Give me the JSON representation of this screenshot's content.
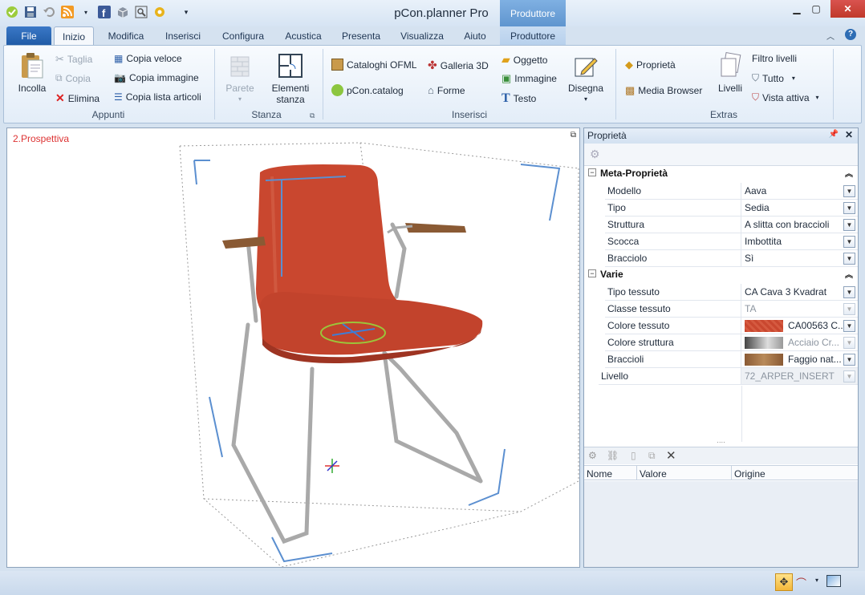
{
  "app": {
    "title": "pCon.planner Pro",
    "context_tab_header": "Produttore"
  },
  "tabs": [
    "File",
    "Inizio",
    "Modifica",
    "Inserisci",
    "Configura",
    "Acustica",
    "Presenta",
    "Visualizza",
    "Aiuto",
    "Produttore"
  ],
  "ribbon": {
    "appunti": {
      "incolla": "Incolla",
      "taglia": "Taglia",
      "copia": "Copia",
      "elimina": "Elimina",
      "copia_veloce": "Copia veloce",
      "copia_immagine": "Copia immagine",
      "copia_lista": "Copia lista articoli",
      "label": "Appunti"
    },
    "stanza": {
      "parete": "Parete",
      "elementi_1": "Elementi",
      "elementi_2": "stanza",
      "label": "Stanza"
    },
    "inserisci": {
      "cataloghi": "Cataloghi OFML",
      "pcon_catalog": "pCon.catalog",
      "galleria": "Galleria 3D",
      "forme": "Forme",
      "oggetto": "Oggetto",
      "immagine": "Immagine",
      "testo": "Testo",
      "disegna": "Disegna",
      "label": "Inserisci"
    },
    "extras": {
      "proprieta": "Proprietà",
      "media": "Media Browser",
      "livelli": "Livelli",
      "filtro": "Filtro livelli",
      "tutto": "Tutto",
      "vista": "Vista attiva",
      "label": "Extras"
    }
  },
  "viewport": {
    "label": "2.Prospettiva"
  },
  "properties": {
    "title": "Proprietà",
    "meta_title": "Meta-Proprietà",
    "meta_rows": [
      {
        "name": "Modello",
        "value": "Aava"
      },
      {
        "name": "Tipo",
        "value": "Sedia"
      },
      {
        "name": "Struttura",
        "value": "A slitta con braccioli"
      },
      {
        "name": "Scocca",
        "value": "Imbottita"
      },
      {
        "name": "Bracciolo",
        "value": "Sì"
      }
    ],
    "varie_title": "Varie",
    "varie_rows": [
      {
        "name": "Tipo tessuto",
        "value": "CA Cava 3 Kvadrat"
      },
      {
        "name": "Classe tessuto",
        "value": "TA"
      },
      {
        "name": "Colore tessuto",
        "value": "CA00563 C..."
      },
      {
        "name": "Colore struttura",
        "value": "Acciaio Cr..."
      },
      {
        "name": "Braccioli",
        "value": "Faggio nat..."
      }
    ],
    "livello": {
      "name": "Livello",
      "value": "72_ARPER_INSERT"
    },
    "columns": [
      "Nome",
      "Valore",
      "Origine"
    ]
  },
  "colors": {
    "chair": "#c9472f",
    "accent": "#2b6cc1"
  }
}
